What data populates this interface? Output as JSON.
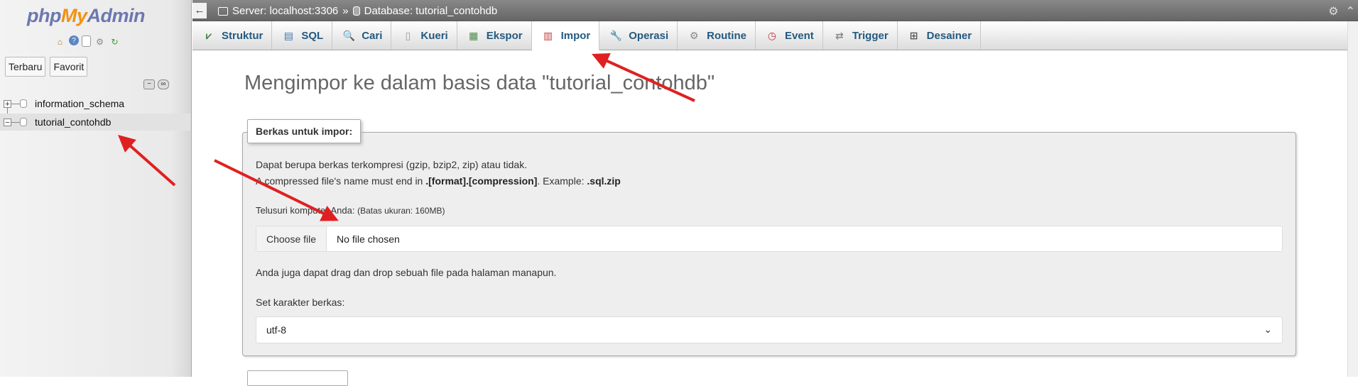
{
  "sidebar": {
    "logo": {
      "php": "php",
      "my": "My",
      "admin": "Admin"
    },
    "quick_icons": [
      "home-icon",
      "help-icon",
      "docs-icon",
      "settings-icon",
      "reload-icon"
    ],
    "recent_label": "Terbaru",
    "favorite_label": "Favorit",
    "databases": [
      {
        "name": "information_schema",
        "expander": "+"
      },
      {
        "name": "tutorial_contohdb",
        "expander": "−"
      }
    ]
  },
  "topbar": {
    "back": "←",
    "server_label": "Server: localhost:3306",
    "separator": "»",
    "database_label": "Database: tutorial_contohdb"
  },
  "tabs": [
    {
      "label": "Struktur",
      "icon": "structure-icon"
    },
    {
      "label": "SQL",
      "icon": "sql-icon"
    },
    {
      "label": "Cari",
      "icon": "search-icon"
    },
    {
      "label": "Kueri",
      "icon": "query-icon"
    },
    {
      "label": "Ekspor",
      "icon": "export-icon"
    },
    {
      "label": "Impor",
      "icon": "import-icon",
      "active": true
    },
    {
      "label": "Operasi",
      "icon": "wrench-icon"
    },
    {
      "label": "Routine",
      "icon": "routine-icon"
    },
    {
      "label": "Event",
      "icon": "clock-icon"
    },
    {
      "label": "Trigger",
      "icon": "trigger-icon"
    },
    {
      "label": "Desainer",
      "icon": "designer-icon"
    }
  ],
  "main": {
    "title": "Mengimpor ke dalam basis data \"tutorial_contohdb\"",
    "fieldset_legend": "Berkas untuk impor:",
    "compression_note": "Dapat berupa berkas terkompresi (gzip, bzip2, zip) atau tidak.",
    "compressed_name_prefix": "A compressed file's name must end in ",
    "compressed_name_format": ".[format].[compression]",
    "compressed_example_prefix": ". Example: ",
    "compressed_example": ".sql.zip",
    "browse_label": "Telusuri komputer Anda: ",
    "size_limit": "(Batas ukuran: 160MB)",
    "choose_file_label": "Choose file",
    "file_status": "No file chosen",
    "drag_note": "Anda juga dapat drag dan drop sebuah file pada halaman manapun.",
    "charset_label": "Set karakter berkas:",
    "charset_value": "utf-8"
  },
  "colors": {
    "annotation_arrow": "#e02020",
    "tab_text": "#235a81",
    "logo_php": "#6c78af",
    "logo_my": "#f29111"
  }
}
